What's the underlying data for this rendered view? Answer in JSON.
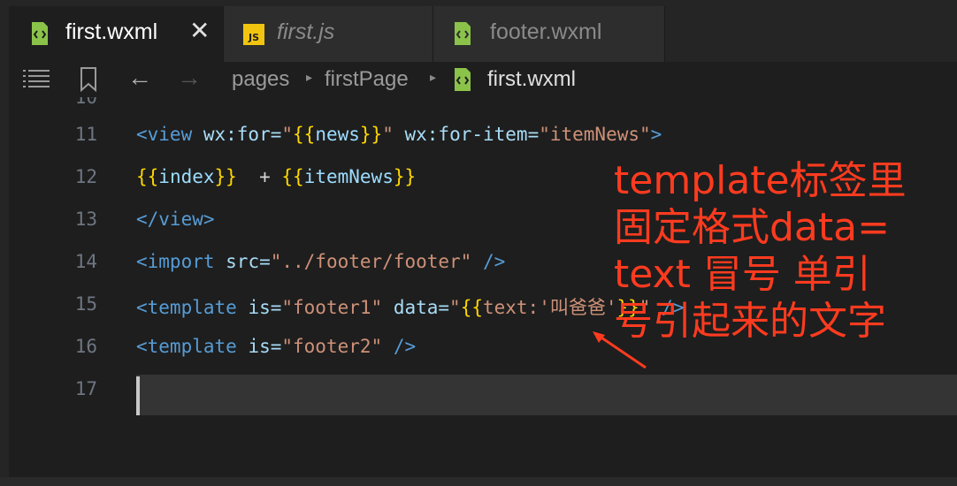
{
  "tabs": [
    {
      "label": "first.wxml",
      "icon": "wxml-file-icon",
      "active": true,
      "italic": false
    },
    {
      "label": "first.js",
      "icon": "js-file-icon",
      "active": false,
      "italic": true
    },
    {
      "label": "footer.wxml",
      "icon": "wxml-file-icon",
      "active": false,
      "italic": false
    }
  ],
  "tab_close_glyph": "✕",
  "js_badge": "JS",
  "breadcrumbs": [
    "pages",
    "firstPage",
    "first.wxml"
  ],
  "toolbar_glyphs": {
    "back": "←",
    "forward": "→"
  },
  "editor": {
    "first_line_partial": "10",
    "line_numbers": [
      "11",
      "12",
      "13",
      "14",
      "15",
      "16",
      "17"
    ],
    "lines": [
      [
        {
          "t": "<view ",
          "c": "tag"
        },
        {
          "t": "wx:for=",
          "c": "attr"
        },
        {
          "t": "\"",
          "c": "str"
        },
        {
          "t": "{{",
          "c": "brace1"
        },
        {
          "t": "news",
          "c": "var"
        },
        {
          "t": "}}",
          "c": "brace1"
        },
        {
          "t": "\" ",
          "c": "str"
        },
        {
          "t": "wx:for-item=",
          "c": "attr"
        },
        {
          "t": "\"itemNews\"",
          "c": "str"
        },
        {
          "t": ">",
          "c": "tag"
        }
      ],
      [
        {
          "t": "{{",
          "c": "brace1"
        },
        {
          "t": "index",
          "c": "var"
        },
        {
          "t": "}}",
          "c": "brace1"
        },
        {
          "t": "  + ",
          "c": "plain"
        },
        {
          "t": "{{",
          "c": "brace1"
        },
        {
          "t": "itemNews",
          "c": "var"
        },
        {
          "t": "}}",
          "c": "brace1"
        }
      ],
      [
        {
          "t": "</view>",
          "c": "tag"
        }
      ],
      [
        {
          "t": "<import ",
          "c": "tag"
        },
        {
          "t": "src=",
          "c": "attr"
        },
        {
          "t": "\"../footer/footer\"",
          "c": "str"
        },
        {
          "t": " />",
          "c": "tag"
        }
      ],
      [
        {
          "t": "<template ",
          "c": "tag"
        },
        {
          "t": "is=",
          "c": "attr"
        },
        {
          "t": "\"footer1\" ",
          "c": "str"
        },
        {
          "t": "data=",
          "c": "attr"
        },
        {
          "t": "\"",
          "c": "str"
        },
        {
          "t": "{{",
          "c": "brace1"
        },
        {
          "t": "text:'叫爸爸'",
          "c": "str"
        },
        {
          "t": "}}",
          "c": "brace1"
        },
        {
          "t": "\"",
          "c": "str"
        },
        {
          "t": " />",
          "c": "tag"
        }
      ],
      [
        {
          "t": "<template ",
          "c": "tag"
        },
        {
          "t": "is=",
          "c": "attr"
        },
        {
          "t": "\"footer2\"",
          "c": "str"
        },
        {
          "t": " />",
          "c": "tag"
        }
      ],
      []
    ]
  },
  "annotation": {
    "lines": [
      "template标签里",
      "固定格式data=",
      "text 冒号 单引",
      "号引起来的文字"
    ],
    "color": "#ff3b1f"
  },
  "colors": {
    "background": "#1e1e1e",
    "tabbar": "#252526",
    "accent_wxml": "#8bc34a",
    "js_badge": "#f1c40f"
  }
}
